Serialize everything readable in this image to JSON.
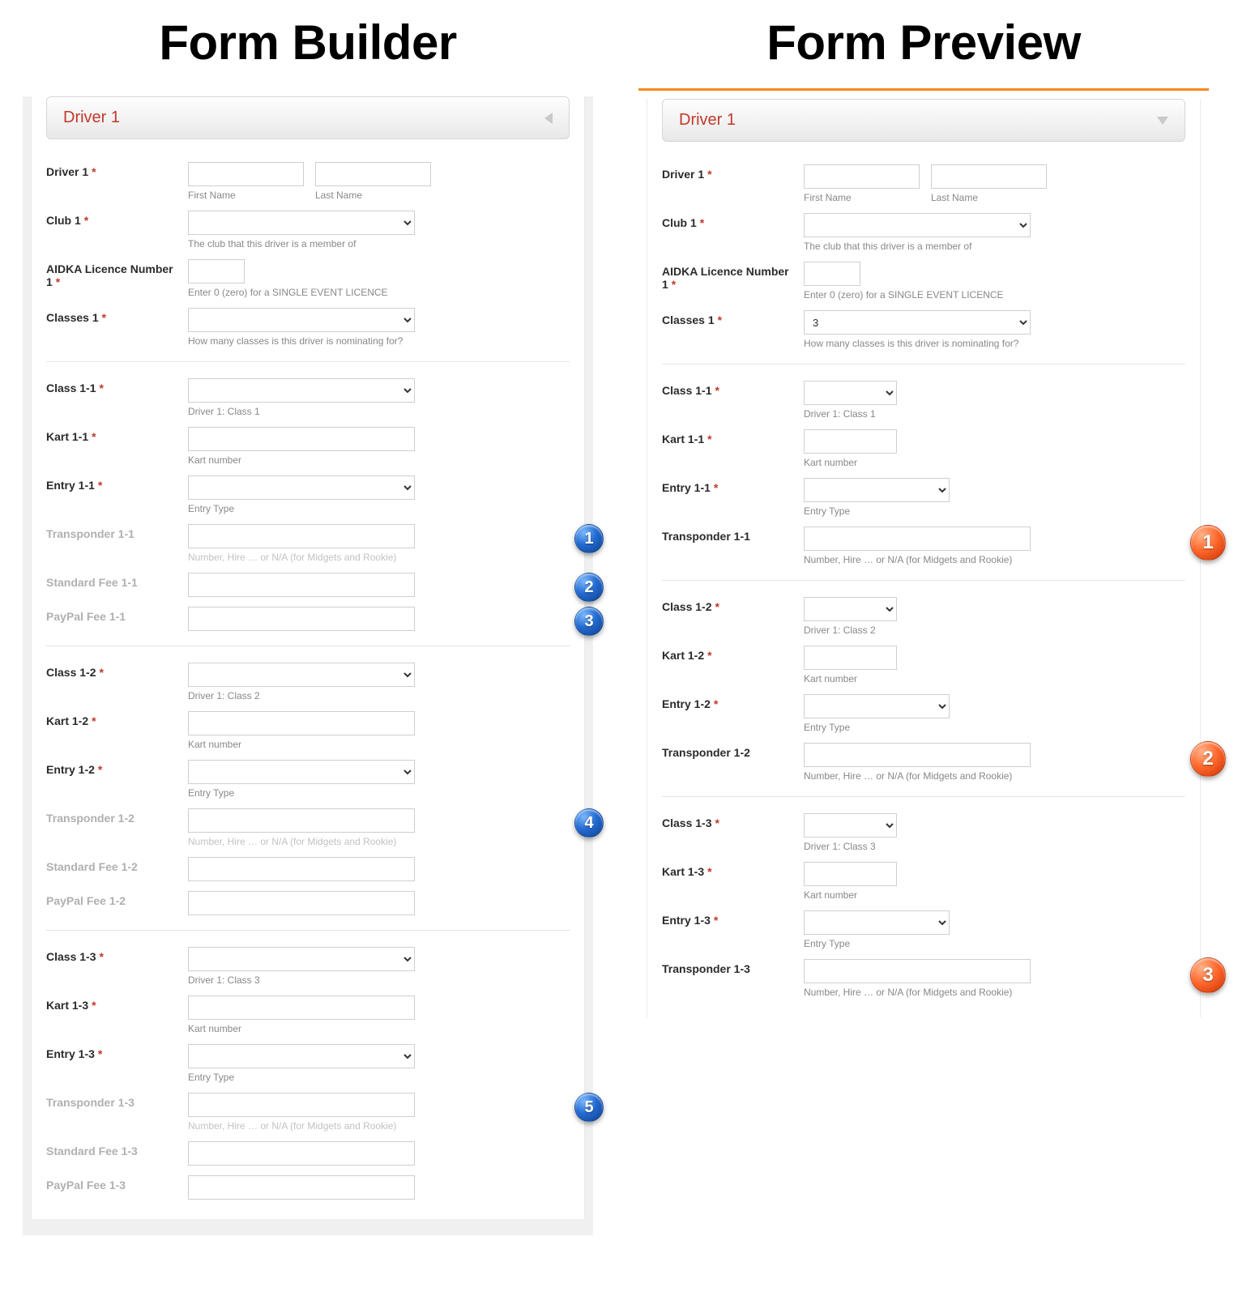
{
  "titles": {
    "left": "Form Builder",
    "right": "Form Preview"
  },
  "accordion": {
    "title": "Driver 1"
  },
  "labels": {
    "driver": "Driver 1",
    "club": "Club 1",
    "licence": "AIDKA Licence Number 1",
    "classes": "Classes 1",
    "first": "First Name",
    "last": "Last Name",
    "class": "Class",
    "kart": "Kart",
    "entry": "Entry",
    "transponder": "Transponder",
    "stdfee": "Standard Fee",
    "ppfee": "PayPal Fee"
  },
  "help": {
    "club": "The club that this driver is a member of",
    "licence": "Enter 0 (zero) for a SINGLE EVENT LICENCE",
    "classes": "How many classes is this driver is nominating for?",
    "classSub": "Driver 1: Class",
    "kart": "Kart number",
    "entry": "Entry Type",
    "transponder": "Number, Hire … or N/A (for Midgets and Rookie)"
  },
  "preview": {
    "classes_value": "3"
  },
  "builder": {
    "groups": [
      {
        "i": "1",
        "bubbles": {
          "trans": "1",
          "std": "2",
          "pp": "3"
        }
      },
      {
        "i": "2",
        "bubbles": {
          "trans": "4"
        }
      },
      {
        "i": "3",
        "bubbles": {
          "trans": "5"
        }
      }
    ]
  },
  "previewGroups": [
    {
      "i": "1",
      "bubble": "1"
    },
    {
      "i": "2",
      "bubble": "2"
    },
    {
      "i": "3",
      "bubble": "3"
    }
  ]
}
